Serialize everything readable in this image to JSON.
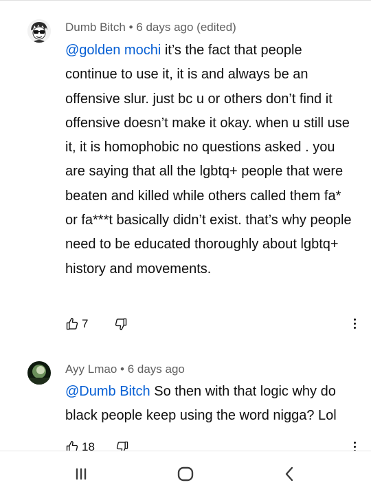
{
  "comments": [
    {
      "author": "Dumb Bitch",
      "meta_sep": " • ",
      "time": "6 days ago (edited)",
      "mention": "@golden mochi",
      "text": " it’s the fact that people continue to use it, it is and always be an offensive slur. just bc u or others don’t find it offensive doesn’t make it okay. when u still use it, it is homophobic no questions asked . you are saying that all the lgbtq+ people that were beaten and killed while others called them fa* or fa***t basically didn’t exist. that’s why people need to be educated thoroughly about lgbtq+ history and movements.",
      "likes": "7",
      "avatar_icon": "sunglasses-avatar-icon"
    },
    {
      "author": "Ayy Lmao",
      "meta_sep": " • ",
      "time": "6 days ago",
      "mention": "@Dumb Bitch",
      "text": " So then with that logic why do black people keep using the word nigga? Lol",
      "likes": "18",
      "avatar_icon": "photo-avatar-icon"
    }
  ],
  "icons": {
    "like": "thumbs-up-icon",
    "dislike": "thumbs-down-icon",
    "more": "more-vert-icon"
  },
  "nav": {
    "recents": "recents-icon",
    "home": "home-icon",
    "back": "back-icon"
  },
  "colors": {
    "mention": "#065fd4",
    "meta": "#606060",
    "text": "#0f0f0f"
  }
}
